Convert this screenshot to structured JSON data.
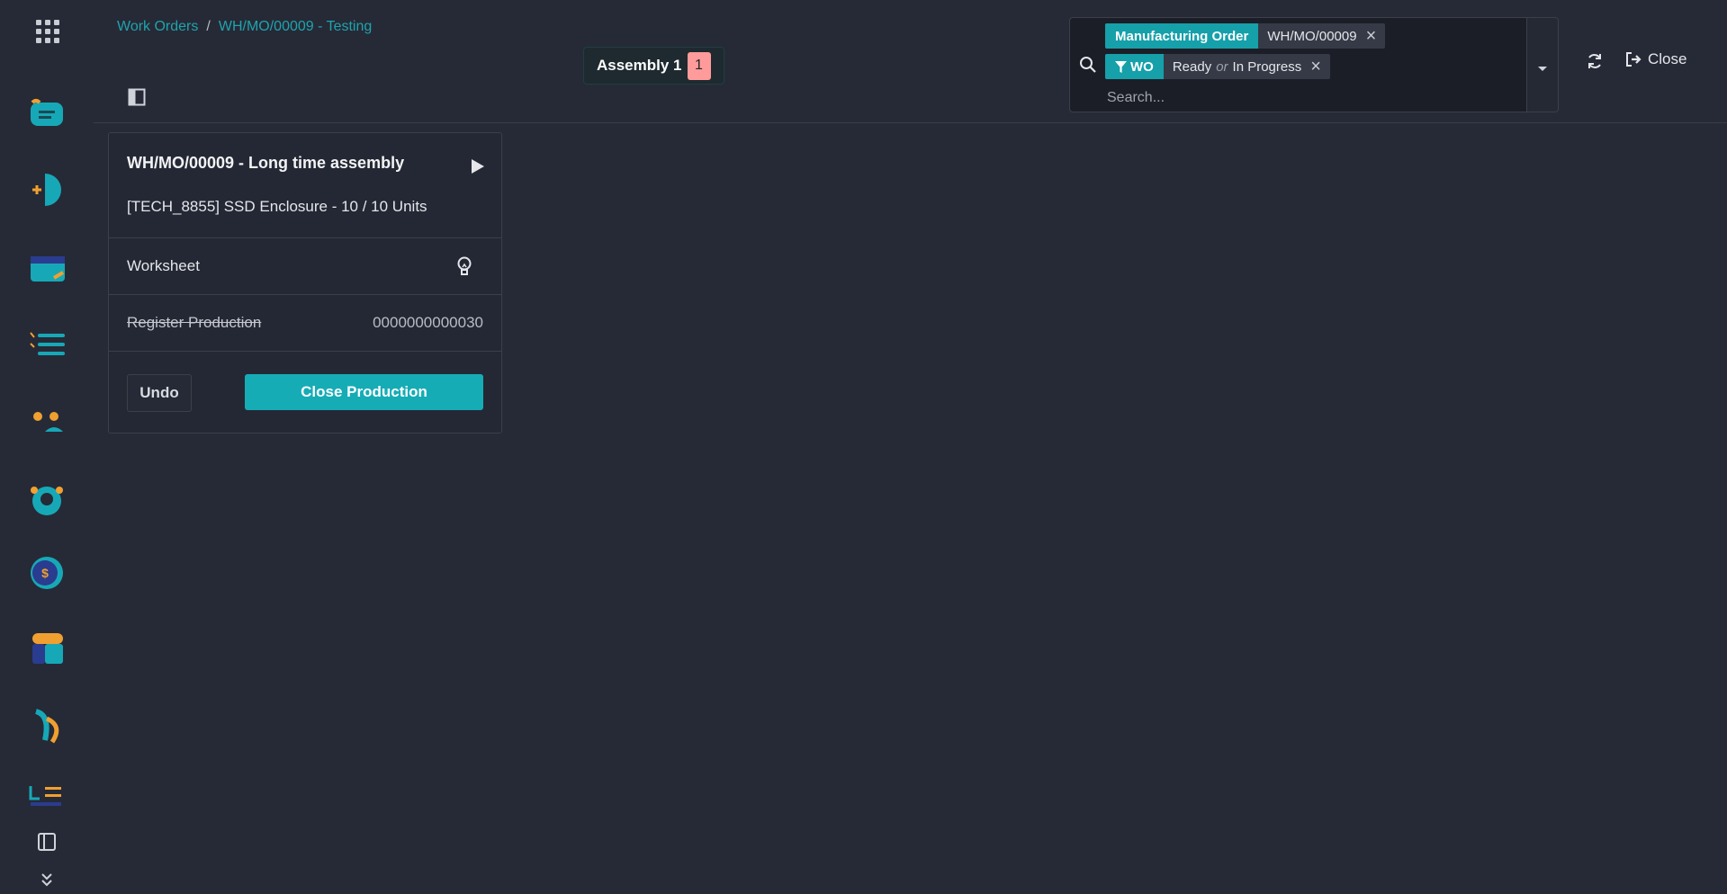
{
  "breadcrumb": {
    "parent": "Work Orders",
    "separator": "/",
    "current": "WH/MO/00009 - Testing"
  },
  "workcenter_tab": {
    "label": "Assembly 1",
    "count": "1"
  },
  "search": {
    "facets": [
      {
        "label": "Manufacturing Order",
        "values": [
          "WH/MO/00009"
        ]
      },
      {
        "label": "WO",
        "values": [
          "Ready",
          "In Progress"
        ],
        "joiner": "or"
      }
    ],
    "placeholder": "Search..."
  },
  "header_actions": {
    "close_label": "Close"
  },
  "workorder_card": {
    "title": "WH/MO/00009 - Long time assembly",
    "product": "[TECH_8855] SSD Enclosure - 10 / 10 Units",
    "steps": [
      {
        "label": "Worksheet",
        "icon": "lightbulb-icon"
      },
      {
        "label": "Register Production",
        "value": "0000000000030",
        "done": true
      }
    ],
    "undo_label": "Undo",
    "close_production_label": "Close Production"
  },
  "colors": {
    "accent": "#15acb6",
    "background": "#262a36",
    "badge": "#ff9b9b",
    "link": "#1fa3ad"
  },
  "sidebar": {
    "apps": [
      "discuss-app-icon",
      "sign-app-icon",
      "documents-app-icon",
      "project-app-icon",
      "employees-app-icon",
      "contacts-app-icon",
      "accounting-app-icon",
      "inventory-app-icon",
      "sales-app-icon",
      "planning-app-icon"
    ]
  }
}
